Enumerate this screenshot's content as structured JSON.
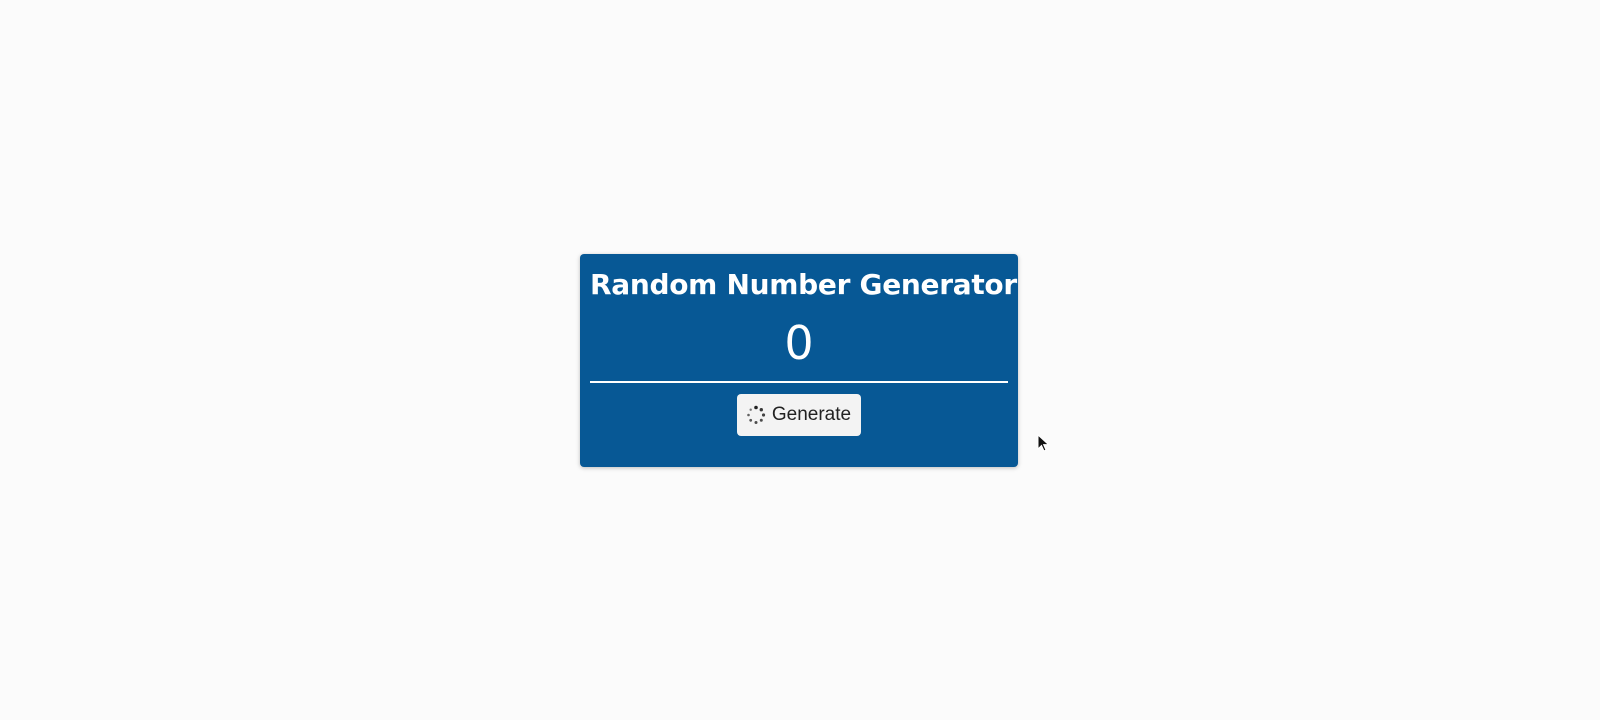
{
  "card": {
    "title": "Random Number Generator",
    "number": "0",
    "background_color": "#075895"
  },
  "generate_button": {
    "label": "Generate",
    "icon": "spinner-icon"
  },
  "cursor": {
    "icon": "mouse-pointer-icon"
  }
}
